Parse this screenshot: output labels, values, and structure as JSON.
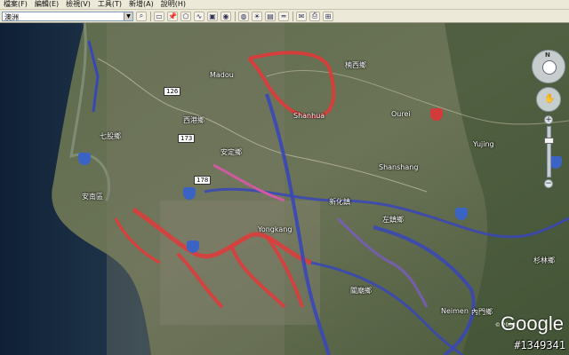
{
  "menu": [
    {
      "label": "檔案(F)"
    },
    {
      "label": "編輯(E)"
    },
    {
      "label": "檢視(V)"
    },
    {
      "label": "工具(T)"
    },
    {
      "label": "新增(A)"
    },
    {
      "label": "說明(H)"
    }
  ],
  "toolbar": {
    "search_value": "澳洲",
    "buttons": [
      "search",
      "hand",
      "placemark",
      "polygon",
      "path",
      "overlay",
      "tour",
      "earth",
      "sun",
      "photo",
      "ruler",
      "email",
      "print",
      "map"
    ]
  },
  "map": {
    "labels": [
      {
        "text": "Madou",
        "id": "madou"
      },
      {
        "text": "Shanhua",
        "id": "shanhua"
      },
      {
        "text": "Ourei",
        "id": "ourei"
      },
      {
        "text": "Yujing",
        "id": "yujing"
      },
      {
        "text": "Shanshang",
        "id": "shanshang"
      },
      {
        "text": "Yongkang",
        "id": "yongkang"
      },
      {
        "text": "Neimen",
        "id": "neimen"
      },
      {
        "text": "楠西鄉",
        "id": "nanxi"
      },
      {
        "text": "安定鄉",
        "id": "anding"
      },
      {
        "text": "安南區",
        "id": "annan"
      },
      {
        "text": "新化鎮",
        "id": "xinhua"
      },
      {
        "text": "左鎮鄉",
        "id": "zuozhen"
      },
      {
        "text": "關廟鄉",
        "id": "guanmiao"
      },
      {
        "text": "內門鄉",
        "id": "neimen2"
      },
      {
        "text": "杉林鄉",
        "id": "shanlin"
      },
      {
        "text": "七股鄉",
        "id": "qigu"
      },
      {
        "text": "西港鄉",
        "id": "xigang"
      }
    ],
    "shields": [
      {
        "text": "126",
        "id": "r126"
      },
      {
        "text": "173",
        "id": "r173"
      },
      {
        "text": "178",
        "id": "r178"
      }
    ],
    "copyright": "© 2008",
    "logo": "Google",
    "image_id": "#1349341"
  },
  "nav": {
    "compass_north": "N",
    "zoom_in": "+",
    "zoom_out": "−",
    "zoom_level": 0.25
  }
}
